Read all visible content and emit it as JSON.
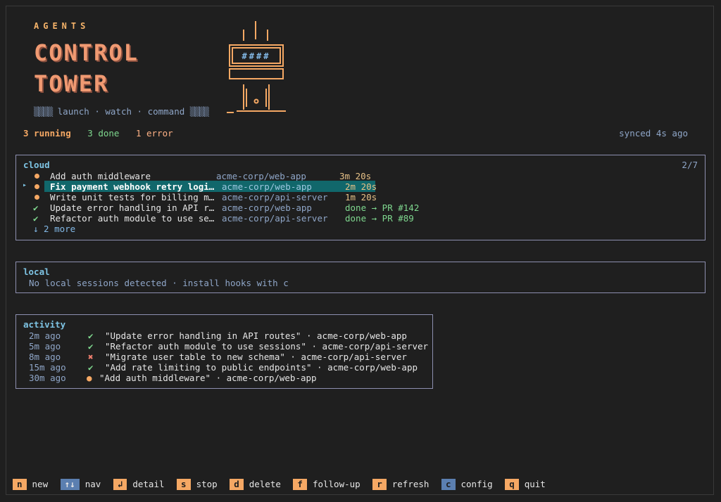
{
  "header": {
    "agents_label": "AGENTS",
    "word1": "CONTROL",
    "word2": "TOWER",
    "tagline_hatch_left": "▒▒▒▒",
    "tagline": "launch · watch · command",
    "tagline_hatch_right": "▒▒▒▒",
    "tower_display": "####"
  },
  "status": {
    "running": "3 running",
    "done": "3 done",
    "error": "1 error",
    "synced": "synced 4s ago"
  },
  "cloud": {
    "title": "cloud",
    "count": "2/7",
    "rows": [
      {
        "state": "running",
        "title": "Add auth middleware",
        "repo": "acme-corp/web-app",
        "meta": "3m 20s"
      },
      {
        "state": "running",
        "title": "Fix payment webhook retry logi…",
        "repo": "acme-corp/web-app",
        "meta": "2m 20s"
      },
      {
        "state": "running",
        "title": "Write unit tests for billing m…",
        "repo": "acme-corp/api-server",
        "meta": "1m 20s"
      },
      {
        "state": "done",
        "title": "Update error handling in API r…",
        "repo": "acme-corp/web-app",
        "meta": "done → PR #142"
      },
      {
        "state": "done",
        "title": "Refactor auth module to use se…",
        "repo": "acme-corp/api-server",
        "meta": "done → PR #89"
      }
    ],
    "more": "↓ 2 more",
    "cursor_glyph": "▸",
    "check_glyph": "✔"
  },
  "local": {
    "title": "local",
    "message": "No local sessions detected · install hooks with c"
  },
  "activity": {
    "title": "activity",
    "rows": [
      {
        "time": "2m ago",
        "icon": "✔",
        "kind": "done",
        "text": "\"Update error handling in API routes\" · acme-corp/web-app"
      },
      {
        "time": "5m ago",
        "icon": "✔",
        "kind": "done",
        "text": "\"Refactor auth module to use sessions\" · acme-corp/api-server"
      },
      {
        "time": "8m ago",
        "icon": "✖",
        "kind": "error",
        "text": "\"Migrate user table to new schema\" · acme-corp/api-server"
      },
      {
        "time": "15m ago",
        "icon": "✔",
        "kind": "done",
        "text": "\"Add rate limiting to public endpoints\" · acme-corp/web-app"
      },
      {
        "time": "30m ago",
        "icon": "●",
        "kind": "running",
        "text": "\"Add auth middleware\" · acme-corp/web-app"
      }
    ]
  },
  "footer": {
    "keys": [
      {
        "key": "n",
        "label": "new"
      },
      {
        "key": "↑↓",
        "label": "nav"
      },
      {
        "key": "↲",
        "label": "detail"
      },
      {
        "key": "s",
        "label": "stop"
      },
      {
        "key": "d",
        "label": "delete"
      },
      {
        "key": "f",
        "label": "follow-up"
      },
      {
        "key": "r",
        "label": "refresh"
      },
      {
        "key": "c",
        "label": "config"
      },
      {
        "key": "q",
        "label": "quit"
      }
    ]
  },
  "colors": {
    "background": "#1f1f1f",
    "accent_orange": "#f5a864",
    "accent_cyan": "#7ec4e4",
    "selection": "#11676b",
    "done_green": "#7fd88f",
    "error_red": "#f07f6f"
  }
}
